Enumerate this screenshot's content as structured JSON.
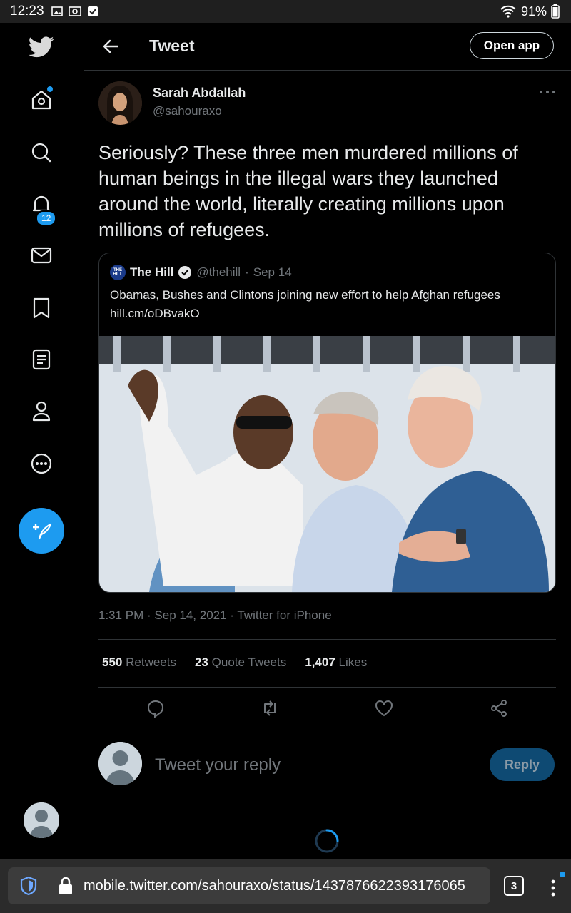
{
  "status_bar": {
    "time": "12:23",
    "battery": "91%"
  },
  "nav": {
    "items": [
      {
        "icon": "home-icon"
      },
      {
        "icon": "search-icon"
      },
      {
        "icon": "notifications-bell-icon",
        "badge": "12"
      },
      {
        "icon": "messages-envelope-icon"
      },
      {
        "icon": "bookmark-icon"
      },
      {
        "icon": "lists-icon"
      },
      {
        "icon": "profile-icon"
      },
      {
        "icon": "more-icon"
      }
    ],
    "compose_icon": "compose-tweet-icon"
  },
  "header": {
    "title": "Tweet",
    "open_app": "Open app"
  },
  "tweet": {
    "author_name": "Sarah Abdallah",
    "author_handle": "@sahouraxo",
    "text": "Seriously? These three men murdered millions of human beings in the illegal wars they launched around the world, literally creating millions upon millions of refugees.",
    "quote": {
      "author_name": "The Hill",
      "author_handle": "@thehill",
      "date": "Sep 14",
      "text": "Obamas, Bushes and Clintons joining new effort to help Afghan refugees",
      "link": "hill.cm/oDBvakO"
    },
    "timestamp": "1:31 PM · Sep 14, 2021 · Twitter for iPhone",
    "stats": {
      "retweets_count": "550",
      "retweets_label": "Retweets",
      "quotes_count": "23",
      "quotes_label": "Quote Tweets",
      "likes_count": "1,407",
      "likes_label": "Likes"
    }
  },
  "reply": {
    "placeholder": "Tweet your reply",
    "button": "Reply"
  },
  "browser": {
    "url": "mobile.twitter.com/sahouraxo/status/1437876622393176065",
    "tab_count": "3"
  },
  "colors": {
    "accent": "#1d9bf0",
    "background": "#000000",
    "secondary_text": "#71767b"
  }
}
